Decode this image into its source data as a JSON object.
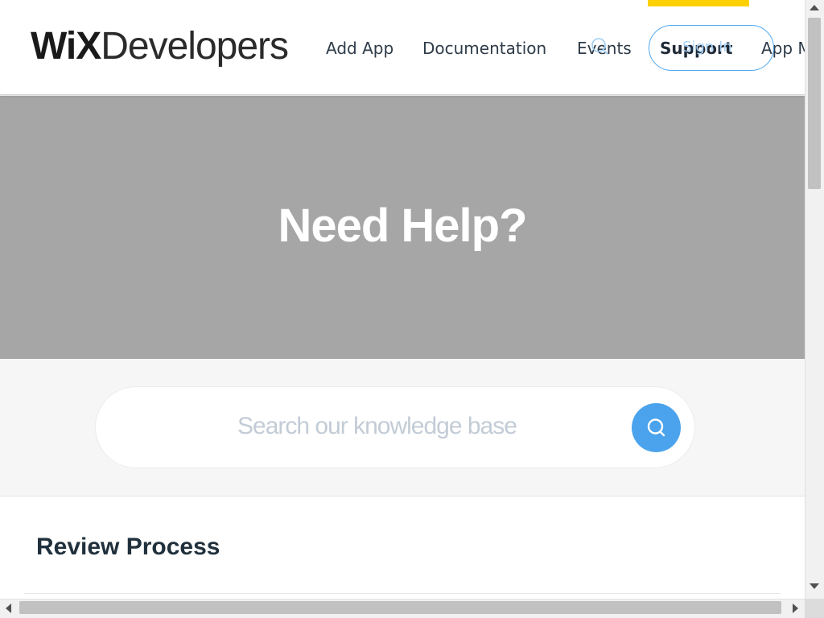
{
  "header": {
    "logo": {
      "brand": "WiX",
      "suffix": "Developers"
    },
    "nav": {
      "add_app": "Add App",
      "documentation": "Documentation",
      "events": "Events",
      "support": "Support",
      "app_market": "App M",
      "sign_in": "Sign In"
    },
    "accent_color": "#fdd000",
    "sign_in_color": "#4ea7ef"
  },
  "hero": {
    "title": "Need Help?",
    "background": "#a5a6a5"
  },
  "search": {
    "placeholder": "Search our knowledge base",
    "button_color": "#4aa3ec",
    "icon": "search-icon"
  },
  "content": {
    "section_title": "Review Process"
  }
}
